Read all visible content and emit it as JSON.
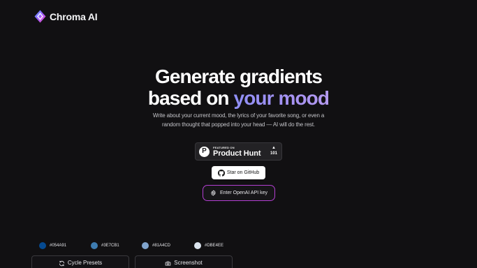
{
  "brand": {
    "name": "Chroma AI",
    "logo_icon": "chroma-diamond-logo"
  },
  "hero": {
    "title_line1": "Generate gradients",
    "title_line2_prefix": "based on ",
    "title_line2_accent": "your mood",
    "subtitle_line1": "Write about your current mood, the lyrics of your favorite song, or even a",
    "subtitle_line2": "random thought that popped into your head — AI will do the rest."
  },
  "product_hunt": {
    "featured_label": "FEATURED ON",
    "name": "Product Hunt",
    "logo_letter": "P",
    "upvote_symbol": "▲",
    "votes": "101"
  },
  "github": {
    "label": "Star on GitHub",
    "icon": "github-icon"
  },
  "api_key": {
    "label": "Enter OpenAI API key",
    "icon": "gear-icon",
    "border_color": "#b33fd2"
  },
  "palette": [
    {
      "hex": "#054A91",
      "label": "#054A91"
    },
    {
      "hex": "#3E7CB1",
      "label": "#3E7CB1"
    },
    {
      "hex": "#81A4CD",
      "label": "#81A4CD"
    },
    {
      "hex": "#DBE4EE",
      "label": "#DBE4EE"
    }
  ],
  "actions": {
    "cycle_presets": {
      "label": "Cycle Presets",
      "icon": "refresh-icon"
    },
    "screenshot": {
      "label": "Screenshot",
      "icon": "camera-icon"
    }
  },
  "colors": {
    "background": "#111012",
    "accent_gradient_start": "#8f8ff6",
    "accent_gradient_end": "#b49af0"
  }
}
